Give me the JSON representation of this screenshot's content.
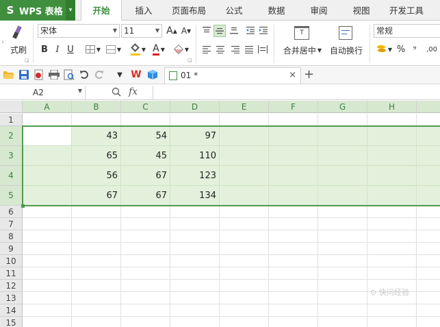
{
  "app": {
    "logo_glyph": "S",
    "title": "WPS 表格",
    "menu_arrow": "▾"
  },
  "ribbon_tabs": [
    {
      "label": "开始",
      "active": true
    },
    {
      "label": "插入"
    },
    {
      "label": "页面布局"
    },
    {
      "label": "公式"
    },
    {
      "label": "数据"
    },
    {
      "label": "审阅"
    },
    {
      "label": "视图"
    },
    {
      "label": "开发工具"
    }
  ],
  "ribbon": {
    "format_painter_label": "式刷",
    "font_name": "宋体",
    "font_size": "11",
    "increase_font": "A",
    "decrease_font": "A",
    "bold": "B",
    "italic": "I",
    "underline": "U",
    "font_color_glyph": "A",
    "merge_label": "合并居中",
    "wrap_label": "自动换行",
    "number_format": "常规",
    "percent": "%",
    "comma_glyph": "⁹",
    "decimal_glyph": ",00",
    "merge_icon_glyph": "T"
  },
  "quickbar": {
    "doc_tab_name": "01 *",
    "close_glyph": "×",
    "new_tab_glyph": "+"
  },
  "formula_bar": {
    "name_box": "A2",
    "fx_label": "fx",
    "formula": ""
  },
  "sheet": {
    "columns": [
      "A",
      "B",
      "C",
      "D",
      "E",
      "F",
      "G",
      "H"
    ],
    "rows": [
      "1",
      "2",
      "3",
      "4",
      "5",
      "6",
      "7",
      "8",
      "9",
      "10",
      "11",
      "12",
      "13",
      "14",
      "15"
    ],
    "data": [
      {
        "row": "2",
        "B": "43",
        "C": "54",
        "D": "97"
      },
      {
        "row": "3",
        "B": "65",
        "C": "45",
        "D": "110"
      },
      {
        "row": "4",
        "B": "56",
        "C": "67",
        "D": "123"
      },
      {
        "row": "5",
        "B": "67",
        "C": "67",
        "D": "134"
      }
    ],
    "selection": "A2:H5",
    "active_cell": "A2"
  },
  "colors": {
    "accent": "#3f8f3f",
    "selection_fill": "#e3f1dc",
    "selection_border": "#4f9a4f"
  },
  "watermark": "⊙ 快问经验"
}
